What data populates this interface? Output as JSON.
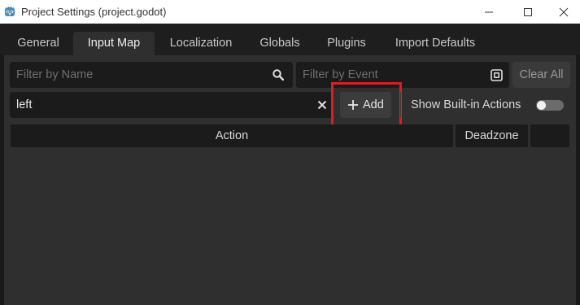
{
  "window": {
    "title": "Project Settings (project.godot)",
    "app_icon": "godot-icon",
    "controls": [
      "minimize-icon",
      "maximize-icon",
      "close-icon"
    ]
  },
  "tabs": [
    {
      "label": "General",
      "active": false
    },
    {
      "label": "Input Map",
      "active": true
    },
    {
      "label": "Localization",
      "active": false
    },
    {
      "label": "Globals",
      "active": false
    },
    {
      "label": "Plugins",
      "active": false
    },
    {
      "label": "Import Defaults",
      "active": false
    }
  ],
  "filters": {
    "name_placeholder": "Filter by Name",
    "name_icon": "search-icon",
    "event_placeholder": "Filter by Event",
    "event_icon": "keyboard-icon",
    "clear_all_label": "Clear All"
  },
  "add_action": {
    "input_value": "left",
    "clear_icon": "close-icon",
    "add_label": "Add",
    "add_icon": "plus-icon",
    "show_builtin_label": "Show Built-in Actions",
    "show_builtin_enabled": false
  },
  "table": {
    "columns": [
      "Action",
      "Deadzone",
      ""
    ],
    "rows": []
  },
  "colors": {
    "highlight": "#d91f26",
    "background": "#191919",
    "panel": "#2f2f2f",
    "field": "#1b1b1b"
  }
}
